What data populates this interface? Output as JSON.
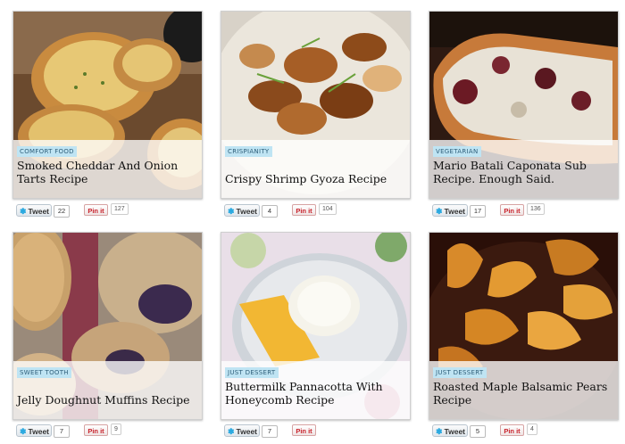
{
  "recipes": [
    {
      "category": "COMFORT FOOD",
      "title": "Smoked Cheddar And Onion Tarts Recipe",
      "tweet_label": "Tweet",
      "tweet_count": "22",
      "pin_label": "Pin it",
      "pin_count": "127"
    },
    {
      "category": "CRISPIANITY",
      "title": "Crispy Shrimp Gyoza Recipe",
      "tweet_label": "Tweet",
      "tweet_count": "4",
      "pin_label": "Pin it",
      "pin_count": "104"
    },
    {
      "category": "VEGETARIAN",
      "title": "Mario Batali Caponata Sub Recipe. Enough Said.",
      "tweet_label": "Tweet",
      "tweet_count": "17",
      "pin_label": "Pin it",
      "pin_count": "136"
    },
    {
      "category": "SWEET TOOTH",
      "title": "Jelly Doughnut Muffins Recipe",
      "tweet_label": "Tweet",
      "tweet_count": "7",
      "pin_label": "Pin it",
      "pin_count": "9"
    },
    {
      "category": "JUST DESSERT",
      "title": "Buttermilk Pannacotta With Honeycomb Recipe",
      "tweet_label": "Tweet",
      "tweet_count": "7",
      "pin_label": "Pin it",
      "pin_count": ""
    },
    {
      "category": "JUST DESSERT",
      "title": "Roasted Maple Balsamic Pears Recipe",
      "tweet_label": "Tweet",
      "tweet_count": "5",
      "pin_label": "Pin it",
      "pin_count": "4"
    }
  ],
  "colors": {
    "tag_bg": "#bfe4f3",
    "tag_text": "#2f5f7a",
    "pin_red": "#c8232c",
    "twitter_blue": "#2aa9e0"
  },
  "icons": {
    "tweet": "twitter-bird-icon"
  }
}
